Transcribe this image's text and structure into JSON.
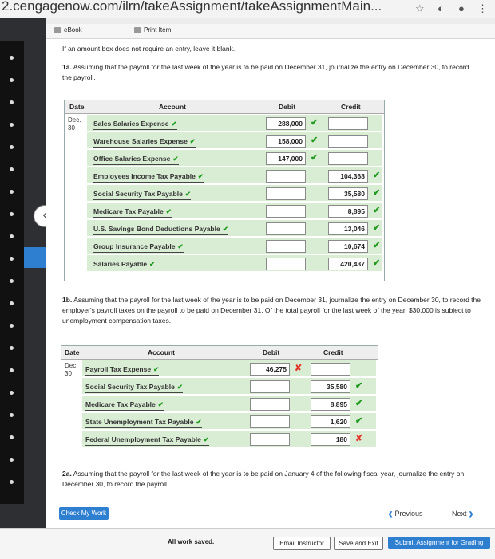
{
  "browser": {
    "url": "2.cengagenow.com/ilrn/takeAssignment/takeAssignmentMain..."
  },
  "tabs": {
    "ebook": "eBook",
    "print": "Print Item"
  },
  "instructions": "If an amount box does not require an entry, leave it blank.",
  "part_1a": {
    "label": "1a.",
    "text": "Assuming that the payroll for the last week of the year is to be paid on December 31, journalize the entry on December 30, to record the payroll.",
    "headers": {
      "date": "Date",
      "account": "Account",
      "debit": "Debit",
      "credit": "Credit"
    },
    "date_month": "Dec.",
    "date_day": "30",
    "rows": [
      {
        "account": "Sales Salaries Expense",
        "debit": "288,000",
        "credit": "",
        "debit_mark": "✔",
        "credit_mark": ""
      },
      {
        "account": "Warehouse Salaries Expense",
        "debit": "158,000",
        "credit": "",
        "debit_mark": "✔",
        "credit_mark": ""
      },
      {
        "account": "Office Salaries Expense",
        "debit": "147,000",
        "credit": "",
        "debit_mark": "✔",
        "credit_mark": ""
      },
      {
        "account": "Employees Income Tax Payable",
        "debit": "",
        "credit": "104,368",
        "debit_mark": "",
        "credit_mark": "✔"
      },
      {
        "account": "Social Security Tax Payable",
        "debit": "",
        "credit": "35,580",
        "debit_mark": "",
        "credit_mark": "✔"
      },
      {
        "account": "Medicare Tax Payable",
        "debit": "",
        "credit": "8,895",
        "debit_mark": "",
        "credit_mark": "✔"
      },
      {
        "account": "U.S. Savings Bond Deductions Payable",
        "debit": "",
        "credit": "13,046",
        "debit_mark": "",
        "credit_mark": "✔"
      },
      {
        "account": "Group Insurance Payable",
        "debit": "",
        "credit": "10,674",
        "debit_mark": "",
        "credit_mark": "✔"
      },
      {
        "account": "Salaries Payable",
        "debit": "",
        "credit": "420,437",
        "debit_mark": "",
        "credit_mark": "✔"
      }
    ]
  },
  "part_1b": {
    "label": "1b.",
    "text": "Assuming that the payroll for the last week of the year is to be paid on December 31, journalize the entry on December 30, to record the employer's payroll taxes on the payroll to be paid on December 31. Of the total payroll for the last week of the year, $30,000 is subject to unemployment compensation taxes.",
    "headers": {
      "date": "Date",
      "account": "Account",
      "debit": "Debit",
      "credit": "Credit"
    },
    "date_month": "Dec.",
    "date_day": "30",
    "rows": [
      {
        "account": "Payroll Tax Expense",
        "debit": "46,275",
        "credit": "",
        "debit_mark": "✘",
        "credit_mark": ""
      },
      {
        "account": "Social Security Tax Payable",
        "debit": "",
        "credit": "35,580",
        "debit_mark": "",
        "credit_mark": "✔"
      },
      {
        "account": "Medicare Tax Payable",
        "debit": "",
        "credit": "8,895",
        "debit_mark": "",
        "credit_mark": "✔"
      },
      {
        "account": "State Unemployment Tax Payable",
        "debit": "",
        "credit": "1,620",
        "debit_mark": "",
        "credit_mark": "✔"
      },
      {
        "account": "Federal Unemployment Tax Payable",
        "debit": "",
        "credit": "180",
        "debit_mark": "",
        "credit_mark": "✘"
      }
    ]
  },
  "part_2a": {
    "label": "2a.",
    "text": "Assuming that the payroll for the last week of the year is to be paid on January 4 of the following fiscal year, journalize the entry on December 30, to record the payroll."
  },
  "buttons": {
    "check_my_work": "Check My Work",
    "previous": "Previous",
    "next": "Next",
    "email": "Email Instructor",
    "save_exit": "Save and Exit",
    "submit": "Submit Assignment for Grading"
  },
  "status": "All work saved.",
  "colors": {
    "accent": "#2f7fd1",
    "row_green": "#d9ecd4",
    "check": "#1f9a1f",
    "cross": "#e23b2e"
  }
}
